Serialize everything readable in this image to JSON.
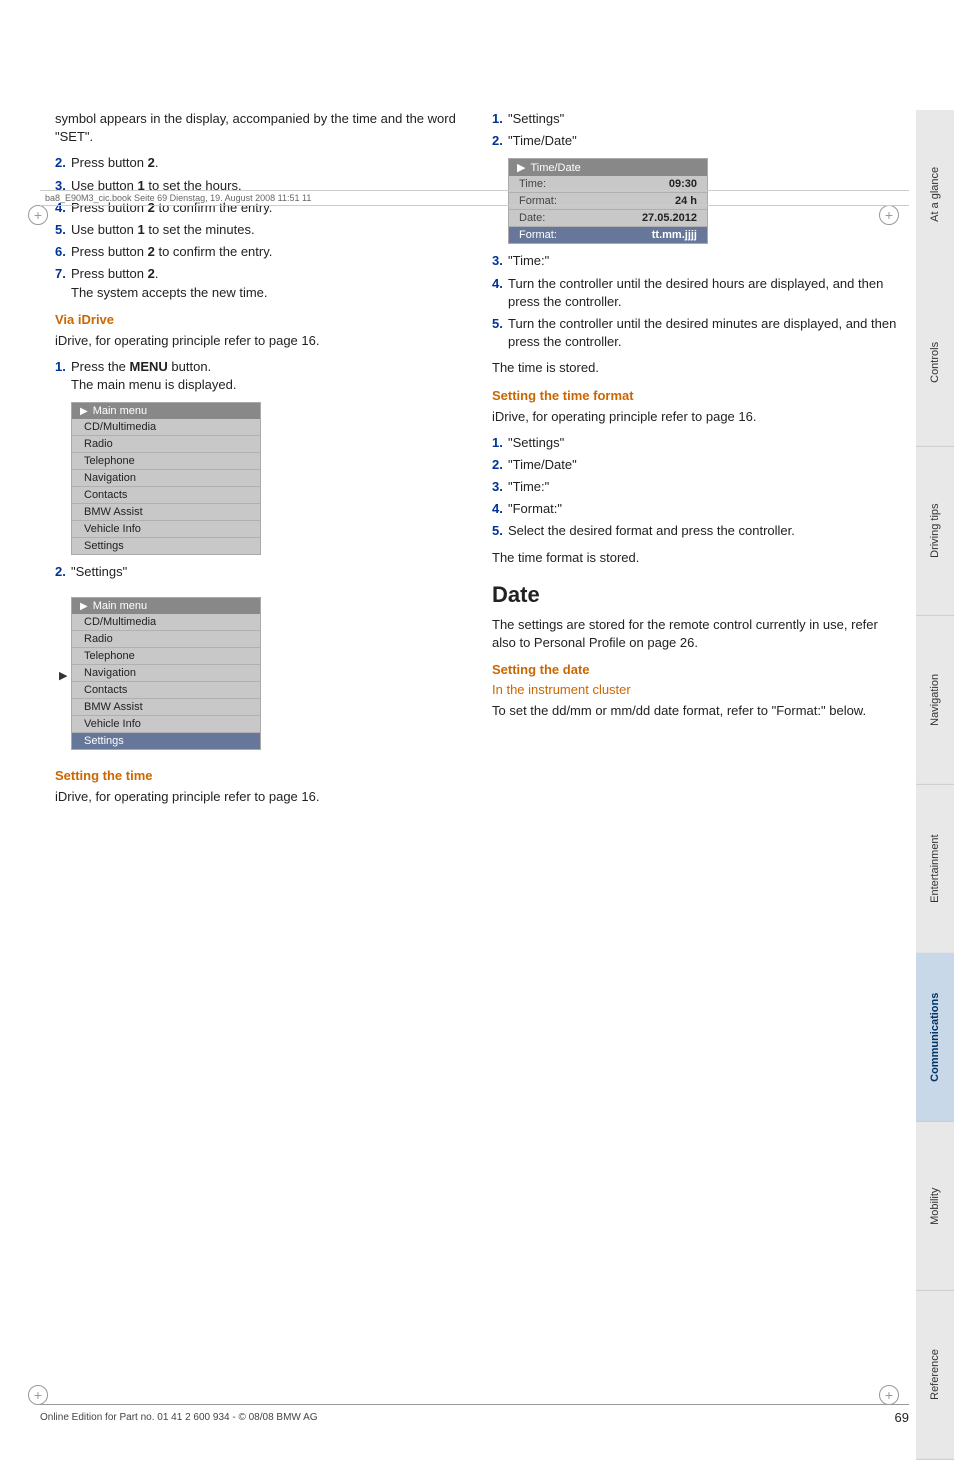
{
  "header": {
    "file_info": "ba8_E90M3_cic.book  Seite 69  Dienstag, 19. August 2008  11:51 11"
  },
  "sidebar": {
    "sections": [
      {
        "label": "At a glance",
        "active": false
      },
      {
        "label": "Controls",
        "active": false
      },
      {
        "label": "Driving tips",
        "active": false
      },
      {
        "label": "Navigation",
        "active": false
      },
      {
        "label": "Entertainment",
        "active": false
      },
      {
        "label": "Communications",
        "active": false
      },
      {
        "label": "Mobility",
        "active": false
      },
      {
        "label": "Reference",
        "active": false
      }
    ]
  },
  "left_col": {
    "intro_text": "symbol appears in the display, accompanied by the time and the word \"SET\".",
    "steps_1": [
      {
        "num": "2.",
        "text": "Press button 2."
      },
      {
        "num": "3.",
        "text": "Use button 1 to set the hours."
      },
      {
        "num": "4.",
        "text": "Press button 2 to confirm the entry."
      },
      {
        "num": "5.",
        "text": "Use button 1 to set the minutes."
      },
      {
        "num": "6.",
        "text": "Press button 2 to confirm the entry."
      },
      {
        "num": "7.",
        "text": "Press button 2."
      }
    ],
    "step7_sub": "The system accepts the new time.",
    "via_idrive_heading": "Via iDrive",
    "via_idrive_text": "iDrive, for operating principle refer to page 16.",
    "menu1_steps": [
      {
        "num": "1.",
        "text": "Press the ",
        "bold": "MENU",
        "text2": " button.",
        "sub": "The main menu is displayed."
      }
    ],
    "menu1": {
      "title": "Main menu",
      "items": [
        "CD/Multimedia",
        "Radio",
        "Telephone",
        "Navigation",
        "Contacts",
        "BMW Assist",
        "Vehicle Info",
        "Settings"
      ],
      "highlighted": ""
    },
    "step2": {
      "num": "2.",
      "text": "\"Settings\""
    },
    "menu2": {
      "title": "Main menu",
      "items": [
        "CD/Multimedia",
        "Radio",
        "Telephone",
        "Navigation",
        "Contacts",
        "BMW Assist",
        "Vehicle Info",
        "Settings"
      ],
      "highlighted": "Settings"
    },
    "setting_time_heading": "Setting the time",
    "setting_time_text": "iDrive, for operating principle refer to page 16."
  },
  "right_col": {
    "steps_initial": [
      {
        "num": "1.",
        "text": "\"Settings\""
      },
      {
        "num": "2.",
        "text": "\"Time/Date\""
      }
    ],
    "timedate_screen": {
      "title": "Time/Date",
      "rows": [
        {
          "label": "Time:",
          "value": "09:30",
          "highlighted": false
        },
        {
          "label": "Format:",
          "value": "24 h",
          "highlighted": false
        },
        {
          "label": "Date:",
          "value": "27.05.2012",
          "highlighted": false
        },
        {
          "label": "Format:",
          "value": "tt.mm.jjjj",
          "highlighted": true
        }
      ]
    },
    "steps_after_screen": [
      {
        "num": "3.",
        "text": "\"Time:\""
      },
      {
        "num": "4.",
        "text": "Turn the controller until the desired hours are displayed, and then press the controller."
      },
      {
        "num": "5.",
        "text": "Turn the controller until the desired minutes are displayed, and then press the controller."
      }
    ],
    "time_stored_text": "The time is stored.",
    "setting_time_format_heading": "Setting the time format",
    "setting_time_format_text": "iDrive, for operating principle refer to page 16.",
    "format_steps": [
      {
        "num": "1.",
        "text": "\"Settings\""
      },
      {
        "num": "2.",
        "text": "\"Time/Date\""
      },
      {
        "num": "3.",
        "text": "\"Time:\""
      },
      {
        "num": "4.",
        "text": "\"Format:\""
      },
      {
        "num": "5.",
        "text": "Select the desired format and press the controller."
      }
    ],
    "time_format_stored": "The time format is stored.",
    "date_heading": "Date",
    "date_text": "The settings are stored for the remote control currently in use, refer also to Personal Profile on page 26.",
    "setting_date_heading": "Setting the date",
    "in_instrument_cluster_heading": "In the instrument cluster",
    "in_instrument_cluster_text": "To set the dd/mm or mm/dd date format, refer to \"Format:\" below."
  },
  "footer": {
    "page_number": "69",
    "copyright": "Online Edition for Part no. 01 41 2 600 934 - © 08/08 BMW AG"
  }
}
